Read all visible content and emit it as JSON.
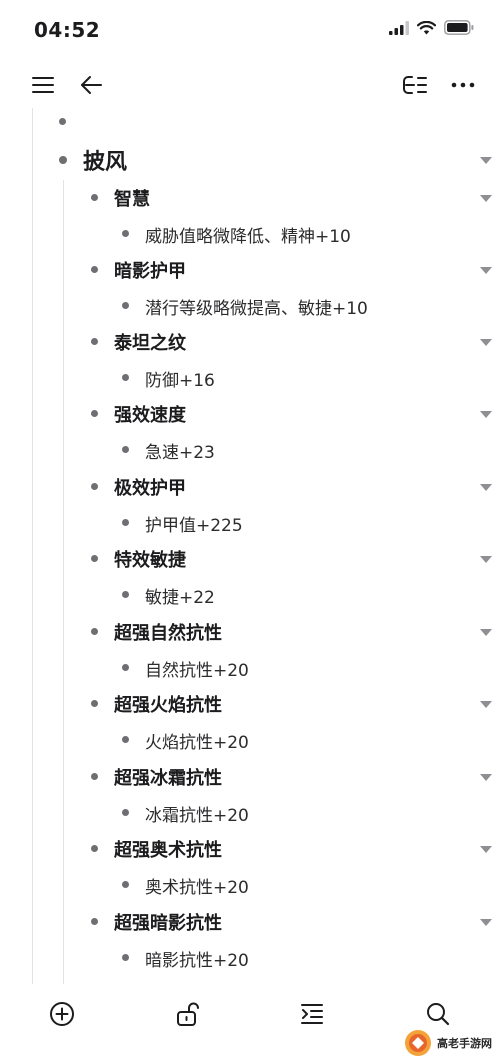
{
  "status": {
    "time": "04:52"
  },
  "icons": {
    "menu": "menu-icon",
    "back": "back-arrow-icon",
    "outline": "outline-view-icon",
    "more": "more-icon",
    "add": "add-circle-icon",
    "unlock": "unlock-icon",
    "indent": "indent-icon",
    "search": "search-icon"
  },
  "outline": {
    "root": {
      "label": "披风",
      "children": [
        {
          "label": "智慧",
          "detail": "威胁值略微降低、精神+10"
        },
        {
          "label": "暗影护甲",
          "detail": "潜行等级略微提高、敏捷+10"
        },
        {
          "label": "泰坦之纹",
          "detail": "防御+16"
        },
        {
          "label": "强效速度",
          "detail": "急速+23"
        },
        {
          "label": "极效护甲",
          "detail": "护甲值+225"
        },
        {
          "label": "特效敏捷",
          "detail": "敏捷+22"
        },
        {
          "label": "超强自然抗性",
          "detail": "自然抗性+20"
        },
        {
          "label": "超强火焰抗性",
          "detail": "火焰抗性+20"
        },
        {
          "label": "超强冰霜抗性",
          "detail": "冰霜抗性+20"
        },
        {
          "label": "超强奥术抗性",
          "detail": "奥术抗性+20"
        },
        {
          "label": "超强暗影抗性",
          "detail": "暗影抗性+20"
        }
      ]
    }
  },
  "watermark": {
    "text": "高老手游网"
  }
}
